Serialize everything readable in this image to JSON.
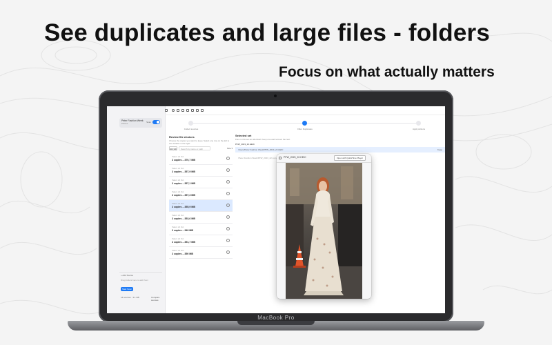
{
  "marketing": {
    "headline": "See duplicates and large files - folders",
    "subheadline": "Focus on what actually matters"
  },
  "device": {
    "brand": "MacBook Pro"
  },
  "app": {
    "sidebar": {
      "card_title": "Peter Fashion Week",
      "card_subtitle": "Photos",
      "toggle_label": "Scan",
      "add_source_label": "+ Add Source",
      "tip_text": "Drag folders here to add them",
      "scan_button": "Start Scan",
      "summary": "14 sources · 3.1 GB",
      "compare_label": "Compare sources"
    },
    "steps": [
      {
        "label": "Collect sources"
      },
      {
        "label": "Filter Duplicates"
      },
      {
        "label": "Apply Actions"
      }
    ],
    "left_panel": {
      "title": "Review file choices",
      "description": "Choose the copies you want to keep. Select one row on the left to see details on the right.",
      "filter_all": "All (14)",
      "search_placeholder": "Search by name or path",
      "sort_label": "Size ▾",
      "rows": [
        {
          "top": "Taken: 21 Oct",
          "main": "2 copies – 370,7 MB"
        },
        {
          "top": "Taken: 21 Oct",
          "main": "2 copies – 357,9 MB"
        },
        {
          "top": "Taken: 21 Oct",
          "main": "2 copies – 357,1 MB"
        },
        {
          "top": "Taken: 21 Oct",
          "main": "2 copies – 357,3 MB"
        },
        {
          "top": "Taken: 21 Oct",
          "main": "2 copies – 355,9 MB"
        },
        {
          "top": "Taken: 21 Oct",
          "main": "2 copies – 353,6 MB"
        },
        {
          "top": "Taken: 21 Oct",
          "main": "2 copies – 349 MB"
        },
        {
          "top": "Taken: 21 Oct",
          "main": "2 copies – 351,7 MB"
        },
        {
          "top": "Taken: 21 Oct",
          "main": "2 copies – 350 MB"
        }
      ],
      "active_row_index": 4
    },
    "right_panel": {
      "title": "Selected set",
      "description": "Files in this set are identical. Keep one and remove the rest.",
      "file_name": "PFW_2023_22.HEIC",
      "selected_path": "/Users/Peter Fashion Week/PFW_2023_22.HEIC",
      "selected_tag": "Keep",
      "other_path": "/Peter Fashion Week/PFW_2023_22 copy.HEIC"
    },
    "quicklook": {
      "file_name": "PFW_2023_22.HEIC",
      "open_button": "Open with QuickTime Player"
    }
  },
  "colors": {
    "accent": "#1e7af5",
    "selection": "#dbe9ff"
  }
}
